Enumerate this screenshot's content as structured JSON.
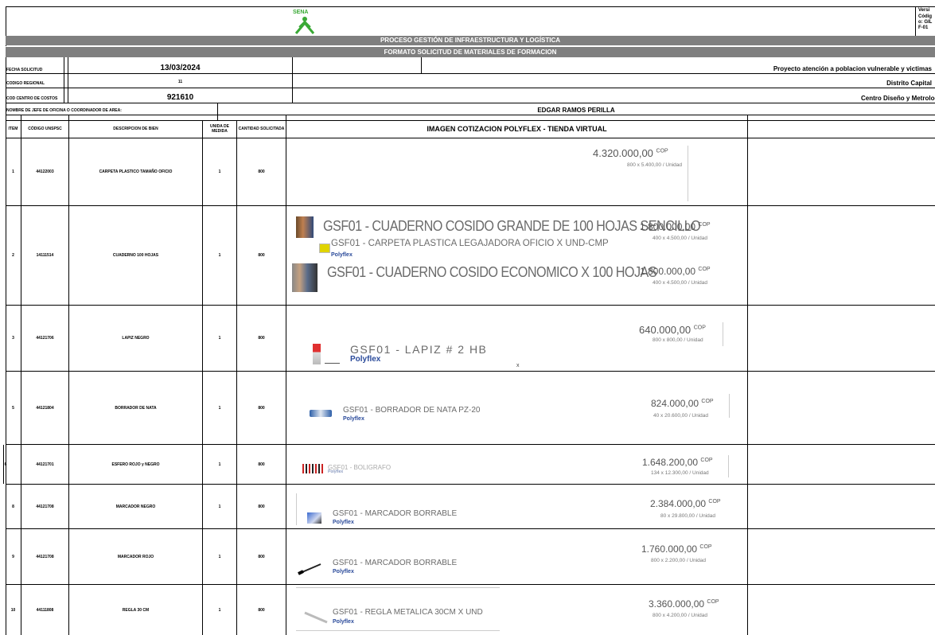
{
  "header": {
    "logo_text": "SENA",
    "version_fragment": "Versi",
    "code_fragment_1": "Códig",
    "code_fragment_2": "o: GIL",
    "code_fragment_3": "F-01",
    "process_title": "PROCESO GESTIÓN DE INFRAESTRUCTURA Y LOGÍSTICA",
    "format_title": "FORMATO SOLICITUD DE MATERIALES DE FORMACION"
  },
  "form": {
    "fecha_label": "FECHA SOLICITUD",
    "fecha_value": "13/03/2024",
    "codigo_regional_label": "CODIGO REGIONAL",
    "codigo_regional_value": "11",
    "centro_costos_label": "COD CENTRO DE COSTOS",
    "centro_costos_value": "921610",
    "proyecto": "Proyecto atención a poblacion vulnerable y victimas",
    "distrito": "Distrito Capital",
    "centro": "Centro Diseño y Metrologia",
    "jefe_label": "NOMBRE DE JEFE DE OFICINA O COORDINADOR DE AREA:",
    "jefe_value": "EDGAR RAMOS PERILLA"
  },
  "table_headers": {
    "item": "ITEM",
    "codigo": "CÓDIGO UNSPSC",
    "descripcion": "DESCRIPCION DE BIEN",
    "unidad": "UNIDA DE MEDIDA",
    "cantidad": "CANTIDAD SOLICITADA",
    "imagen": "IMAGEN COTIZACION POLYFLEX - TIENDA VIRTUAL"
  },
  "rows": [
    {
      "item": "1",
      "codigo": "44122003",
      "descripcion": "CARPETA PLASTICO TAMAÑO OFICIO",
      "unidad": "1",
      "cantidad": "800"
    },
    {
      "item": "2",
      "codigo": "14111514",
      "descripcion": "CUADERNO 100 HOJAS",
      "unidad": "1",
      "cantidad": "800"
    },
    {
      "item": "3",
      "codigo": "44121706",
      "descripcion": "LAPIZ NEGRO",
      "unidad": "1",
      "cantidad": "800"
    },
    {
      "item": "5",
      "codigo": "44121804",
      "descripcion": "BORRADOR DE NATA",
      "unidad": "1",
      "cantidad": "800"
    },
    {
      "item": "6",
      "codigo": "44121701",
      "descripcion": "ESFERO ROJO y NEGRO",
      "unidad": "1",
      "cantidad": "800"
    },
    {
      "item": "8",
      "codigo": "44121708",
      "descripcion": "MARCADOR NEGRO",
      "unidad": "1",
      "cantidad": "800"
    },
    {
      "item": "9",
      "codigo": "44121708",
      "descripcion": "MARCADOR ROJO",
      "unidad": "1",
      "cantidad": "800"
    },
    {
      "item": "10",
      "codigo": "44111808",
      "descripcion": "REGLA 30 CM",
      "unidad": "1",
      "cantidad": "800"
    }
  ],
  "products": {
    "p1": {
      "title": "GSF01 - CARPETA PLASTICA LEGAJADORA OFICIO X UND-CMP",
      "brand": "Polyflex",
      "price": "4.320.000,00",
      "cop": "COP",
      "qty": "800 x 5.400,00 / Unidad"
    },
    "p2a": {
      "title": "GSF01 - CUADERNO COSIDO GRANDE DE 100 HOJAS SENCILLO",
      "price": "1.800.000,00",
      "cop": "COP",
      "qty": "400 x 4.500,00 / Unidad"
    },
    "p2b": {
      "title": "GSF01 - CUADERNO COSIDO ECONOMICO X 100 HOJAS",
      "price": "1.800.000,00",
      "cop": "COP",
      "qty": "400 x 4.500,00 / Unidad"
    },
    "p3": {
      "title": "GSF01 - LAPIZ # 2 HB",
      "brand": "Polyflex",
      "price": "640.000,00",
      "cop": "COP",
      "qty": "800 x 800,00 / Unidad",
      "mark": "x"
    },
    "p5": {
      "title": "GSF01 - BORRADOR DE NATA PZ-20",
      "brand": "Polyflex",
      "price": "824.000,00",
      "cop": "COP",
      "qty": "40 x 20.600,00 / Unidad"
    },
    "p6": {
      "title": "GSF01 - BOLIGRAFO",
      "brand": "Polyflex",
      "price": "1.648.200,00",
      "cop": "COP",
      "qty": "134 x 12.300,00 / Unidad"
    },
    "p8": {
      "title": "GSF01 - MARCADOR BORRABLE",
      "brand": "Polyflex",
      "price": "2.384.000,00",
      "cop": "COP",
      "qty": "80 x 29.800,00 / Unidad"
    },
    "p9": {
      "title": "GSF01 - MARCADOR BORRABLE",
      "brand": "Polyflex",
      "price": "1.760.000,00",
      "cop": "COP",
      "qty": "800 x 2.200,00 / Unidad"
    },
    "p10": {
      "title": "GSF01 - REGLA METALICA 30CM X UND",
      "brand": "Polyflex",
      "price": "3.360.000,00",
      "cop": "COP",
      "qty": "800 x 4.200,00 / Unidad"
    }
  },
  "colors": {
    "band": "#7f7f7f",
    "logo_green": "#39a935",
    "brand_blue": "#2a4a9a"
  }
}
